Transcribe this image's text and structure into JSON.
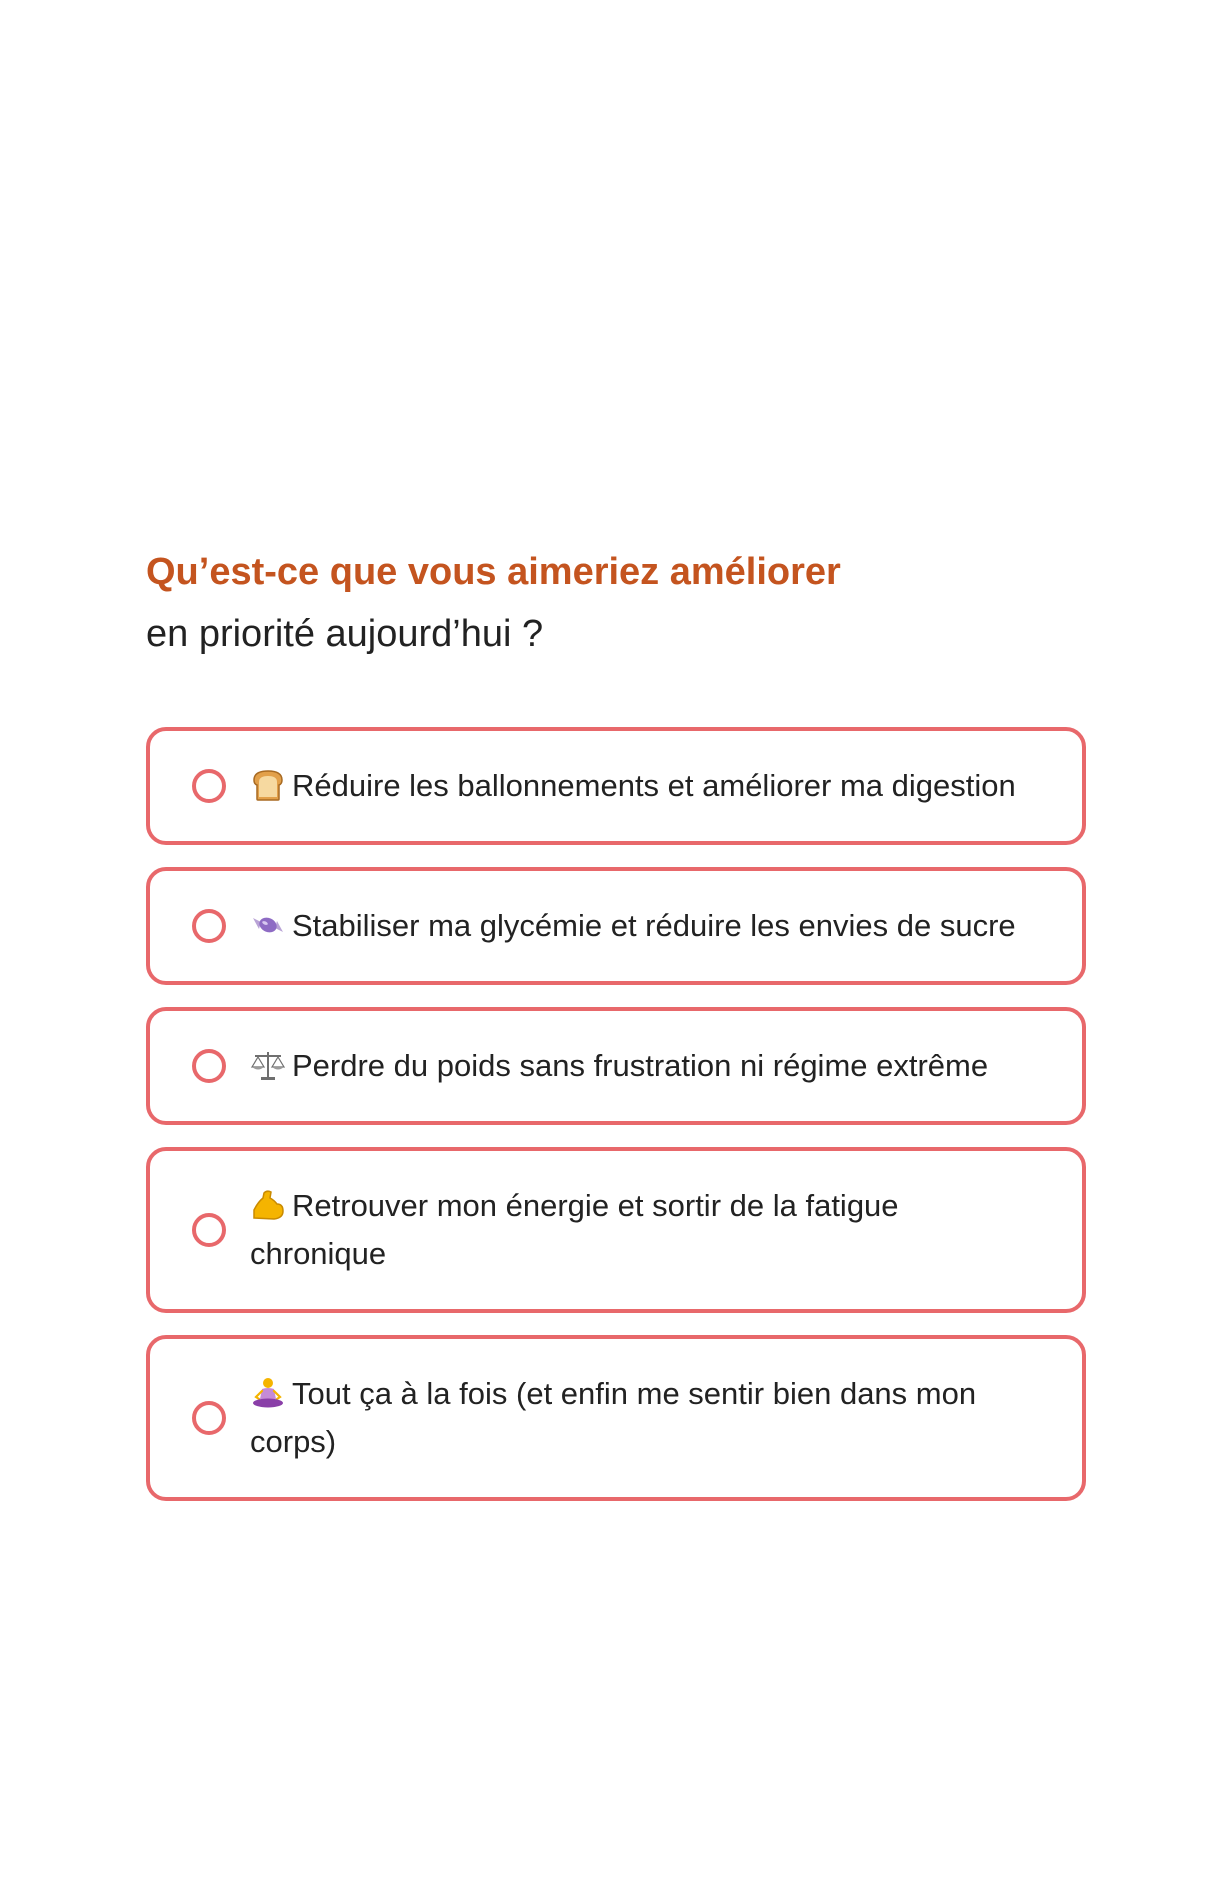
{
  "question": {
    "title": "Qu’est-ce que vous aimeriez améliorer",
    "subtitle": "en priorité aujourd’hui ?"
  },
  "options": [
    {
      "icon": "bread-icon",
      "label": "Réduire les ballonnements et améliorer ma digestion"
    },
    {
      "icon": "candy-icon",
      "label": "Stabiliser ma glycémie et réduire les envies de sucre"
    },
    {
      "icon": "balance-scale-icon",
      "label": "Perdre du poids sans frustration ni régime extrême"
    },
    {
      "icon": "flexed-biceps-icon",
      "label": "Retrouver mon énergie et sortir de la fatigue chronique"
    },
    {
      "icon": "person-meditating-icon",
      "label": "Tout ça à la fois (et enfin me sentir bien dans mon corps)"
    }
  ],
  "colors": {
    "accent_title": "#c4541f",
    "option_border": "#e8686b",
    "text": "#222222"
  }
}
